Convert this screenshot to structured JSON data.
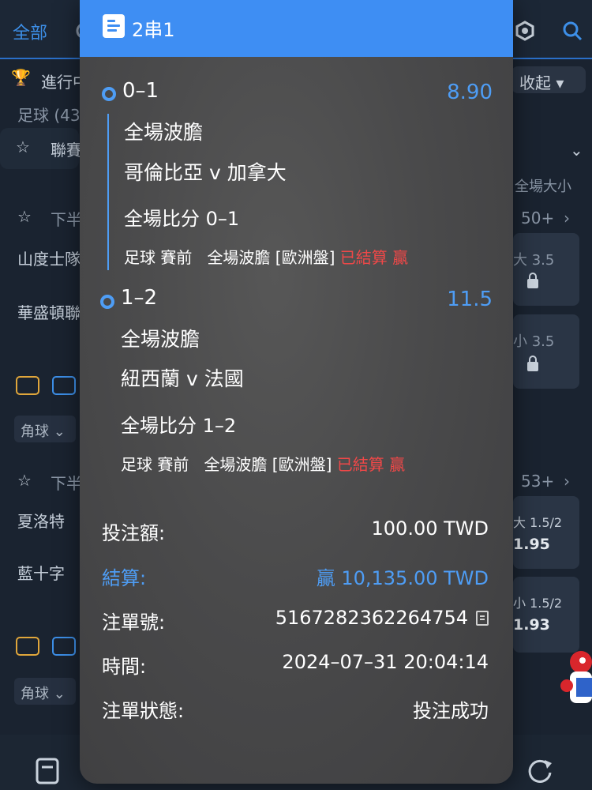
{
  "background": {
    "tab_all": "全部",
    "in_play": "進行中",
    "sport_count": "足球 (43",
    "collapse": "收起",
    "league": "聯賽",
    "total_label": "全場大小",
    "half1": "下半",
    "count1": "50+",
    "count2": "53+",
    "team1": "山度士隊",
    "team2": "華盛頓聯",
    "team3": "夏洛特",
    "team4": "藍十字",
    "odds1_label": "大 3.5",
    "odds2_label": "小 3.5",
    "odds3_label": "大 1.5/2",
    "odds3_value": "1.95",
    "odds4_label": "小 1.5/2",
    "odds4_value": "1.93",
    "corner": "角球"
  },
  "modal": {
    "title": "2串1",
    "legs": [
      {
        "score": "0–1",
        "odds": "8.90",
        "market": "全場波膽",
        "match": "哥倫比亞 v 加拿大",
        "selection": "全場比分 0–1",
        "sport": "足球",
        "phase": "賽前",
        "market_detail": "全場波膽 [歐洲盤]",
        "status": "已結算",
        "result": "贏"
      },
      {
        "score": "1–2",
        "odds": "11.5",
        "market": "全場波膽",
        "match": "紐西蘭 v 法國",
        "selection": "全場比分 1–2",
        "sport": "足球",
        "phase": "賽前",
        "market_detail": "全場波膽 [歐洲盤]",
        "status": "已結算",
        "result": "贏"
      }
    ],
    "info": {
      "stake_label": "投注額:",
      "stake_value": "100.00 TWD",
      "settle_label": "結算:",
      "settle_value": "贏 10,135.00 TWD",
      "ticket_label": "注單號:",
      "ticket_value": "5167282362264754",
      "time_label": "時間:",
      "time_value": "2024–07–31 20:04:14",
      "state_label": "注單狀態:",
      "state_value": "投注成功"
    }
  }
}
